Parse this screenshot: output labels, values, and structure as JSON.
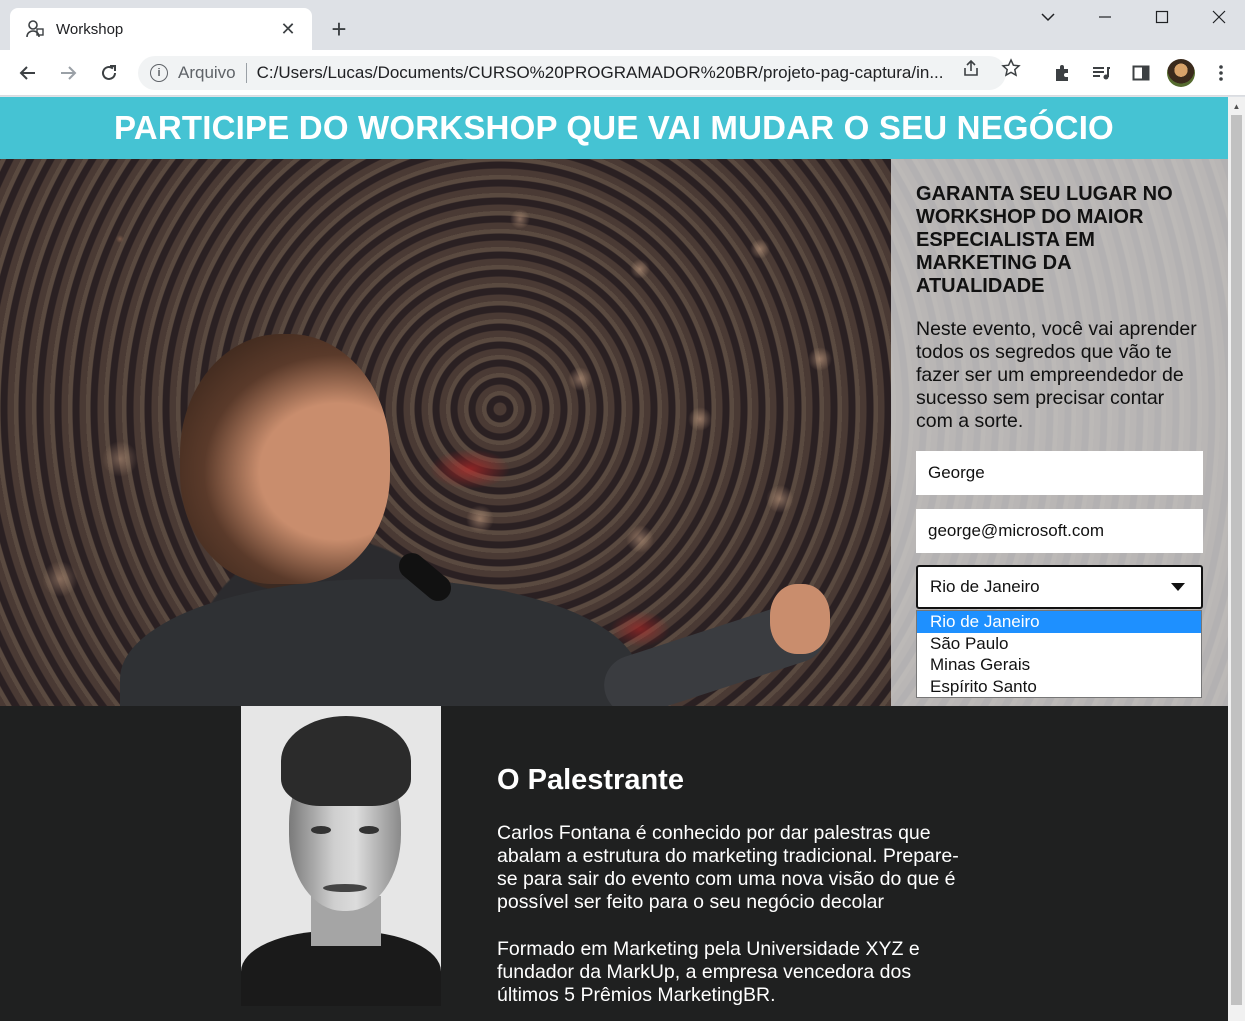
{
  "browser": {
    "tab_title": "Workshop",
    "tab_close": "✕",
    "new_tab": "+",
    "scheme_label": "Arquivo",
    "url": "C:/Users/Lucas/Documents/CURSO%20PROGRAMADOR%20BR/projeto-pag-captura/in..."
  },
  "page": {
    "banner_title": "PARTICIPE DO WORKSHOP QUE VAI MUDAR O SEU NEGÓCIO",
    "form": {
      "title": "GARANTA SEU LUGAR NO WORKSHOP DO MAIOR ESPECIALISTA EM MARKETING DA ATUALIDADE",
      "description": "Neste evento, você vai aprender todos os segredos que vão te fazer ser um empreendedor de sucesso sem precisar contar com a sorte.",
      "name_value": "George",
      "email_value": "george@microsoft.com",
      "state_selected": "Rio de Janeiro",
      "state_options": [
        "Rio de Janeiro",
        "São Paulo",
        "Minas Gerais",
        "Espírito Santo"
      ]
    },
    "speaker": {
      "heading": "O Palestrante",
      "bio_1": "Carlos Fontana é conhecido por dar palestras que abalam a estrutura do marketing tradicional. Prepare-se para sair do evento com uma nova visão do que é possível ser feito para o seu negócio decolar",
      "bio_2": "Formado em Marketing pela Universidade XYZ e fundador da MarkUp, a empresa vencedora dos últimos 5 Prêmios MarketingBR."
    }
  },
  "colors": {
    "banner": "#45c3d3",
    "speaker_bg": "#1f2020",
    "selected_option": "#1e90ff"
  }
}
